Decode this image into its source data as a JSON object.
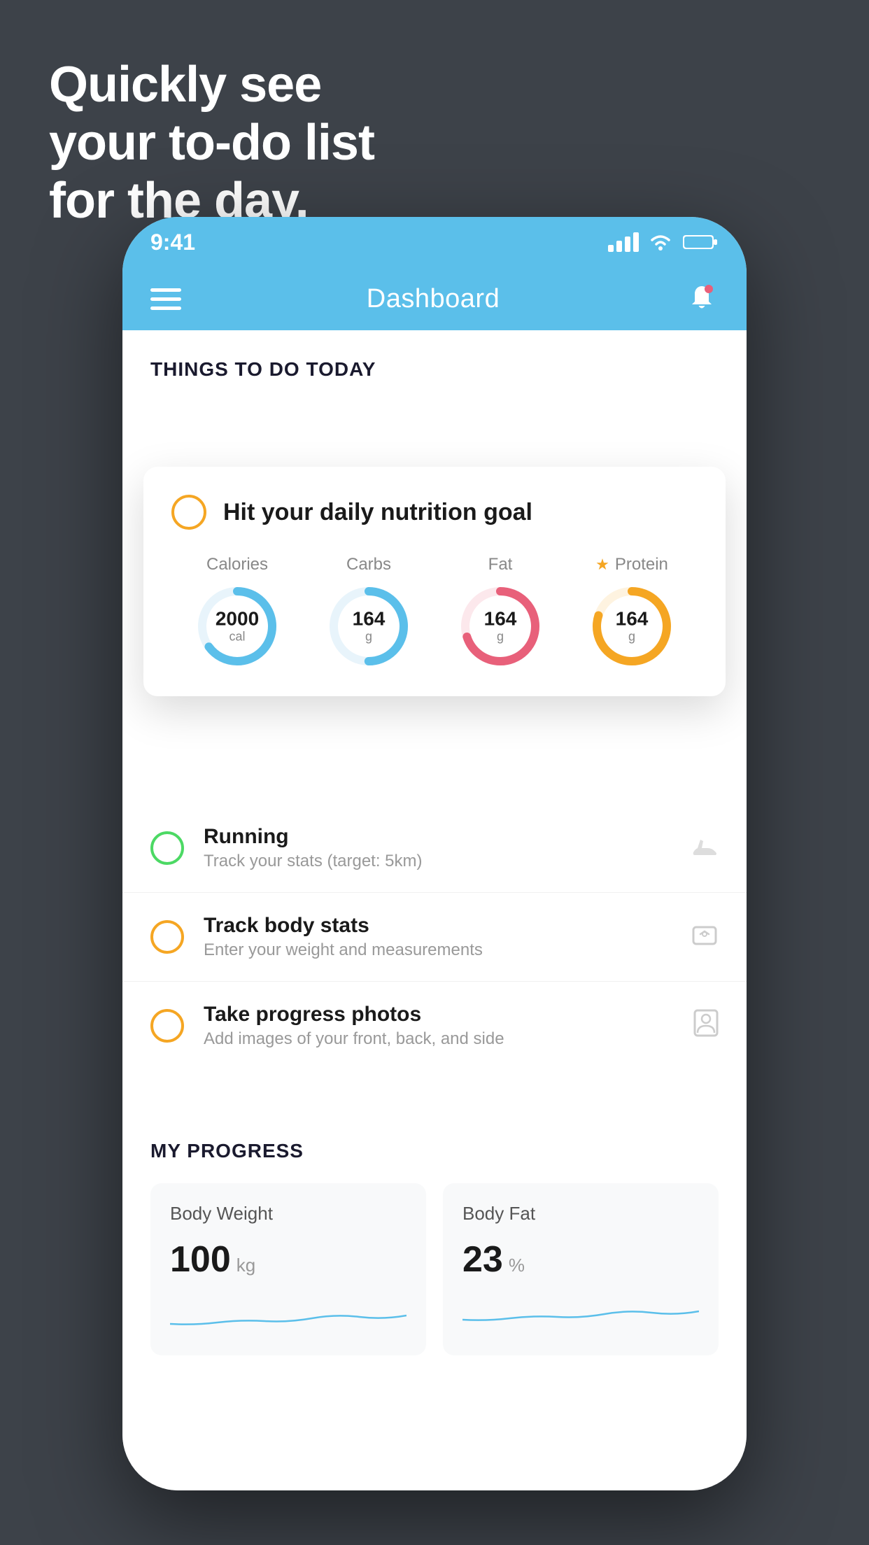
{
  "hero": {
    "line1": "Quickly see",
    "line2": "your to-do list",
    "line3": "for the day."
  },
  "status_bar": {
    "time": "9:41",
    "wifi": true,
    "battery": true
  },
  "header": {
    "title": "Dashboard"
  },
  "things_title": "THINGS TO DO TODAY",
  "nutrition_card": {
    "title": "Hit your daily nutrition goal",
    "macros": [
      {
        "label": "Calories",
        "value": "2000",
        "unit": "cal",
        "color": "#5bbfea",
        "progress": 65,
        "starred": false
      },
      {
        "label": "Carbs",
        "value": "164",
        "unit": "g",
        "color": "#5bbfea",
        "progress": 50,
        "starred": false
      },
      {
        "label": "Fat",
        "value": "164",
        "unit": "g",
        "color": "#e8607a",
        "progress": 70,
        "starred": false
      },
      {
        "label": "Protein",
        "value": "164",
        "unit": "g",
        "color": "#f5a623",
        "progress": 80,
        "starred": true
      }
    ]
  },
  "todo_items": [
    {
      "title": "Running",
      "subtitle": "Track your stats (target: 5km)",
      "circle_color": "green",
      "icon": "shoe"
    },
    {
      "title": "Track body stats",
      "subtitle": "Enter your weight and measurements",
      "circle_color": "yellow",
      "icon": "scale"
    },
    {
      "title": "Take progress photos",
      "subtitle": "Add images of your front, back, and side",
      "circle_color": "yellow",
      "icon": "person"
    }
  ],
  "progress_section": {
    "title": "MY PROGRESS",
    "cards": [
      {
        "title": "Body Weight",
        "value": "100",
        "unit": "kg"
      },
      {
        "title": "Body Fat",
        "value": "23",
        "unit": "%"
      }
    ]
  }
}
